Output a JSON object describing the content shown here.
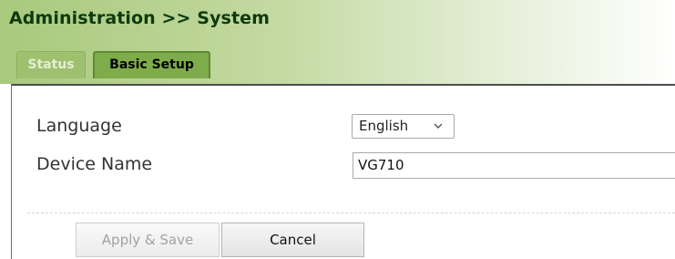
{
  "header": {
    "title": "Administration >> System"
  },
  "tabs": [
    {
      "label": "Status",
      "active": false
    },
    {
      "label": "Basic Setup",
      "active": true
    }
  ],
  "form": {
    "language": {
      "label": "Language",
      "selected": "English",
      "icon": "chevron-down-icon"
    },
    "device_name": {
      "label": "Device Name",
      "value": "VG710"
    }
  },
  "buttons": {
    "apply_label": "Apply & Save",
    "apply_enabled": false,
    "cancel_label": "Cancel"
  },
  "colors": {
    "header_green": "#a9c97c",
    "active_tab": "#7fac4b",
    "inactive_tab": "#9fc06f",
    "title_text": "#0d3a0d"
  }
}
